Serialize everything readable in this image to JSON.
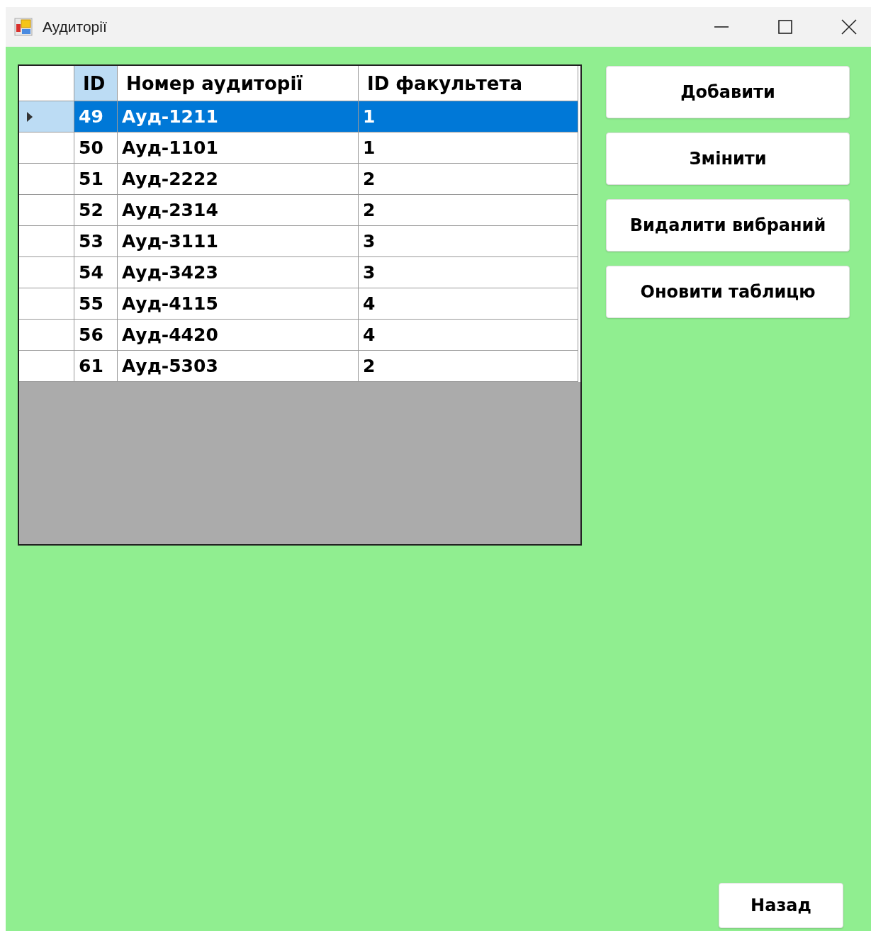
{
  "window": {
    "title": "Аудиторії"
  },
  "table": {
    "columns": [
      {
        "label": "ID",
        "highlighted": true
      },
      {
        "label": "Номер аудиторії",
        "highlighted": false
      },
      {
        "label": "ID факультета",
        "highlighted": false
      }
    ],
    "rows": [
      {
        "cells": [
          "49",
          "Ауд-1211",
          "1"
        ],
        "selected": true
      },
      {
        "cells": [
          "50",
          "Ауд-1101",
          "1"
        ],
        "selected": false
      },
      {
        "cells": [
          "51",
          "Ауд-2222",
          "2"
        ],
        "selected": false
      },
      {
        "cells": [
          "52",
          "Ауд-2314",
          "2"
        ],
        "selected": false
      },
      {
        "cells": [
          "53",
          "Ауд-3111",
          "3"
        ],
        "selected": false
      },
      {
        "cells": [
          "54",
          "Ауд-3423",
          "3"
        ],
        "selected": false
      },
      {
        "cells": [
          "55",
          "Ауд-4115",
          "4"
        ],
        "selected": false
      },
      {
        "cells": [
          "56",
          "Ауд-4420",
          "4"
        ],
        "selected": false
      },
      {
        "cells": [
          "61",
          "Ауд-5303",
          "2"
        ],
        "selected": false
      }
    ]
  },
  "buttons": [
    "Добавити",
    "Змінити",
    "Видалити вибраний",
    "Оновити таблицю"
  ],
  "back_button": "Назад"
}
